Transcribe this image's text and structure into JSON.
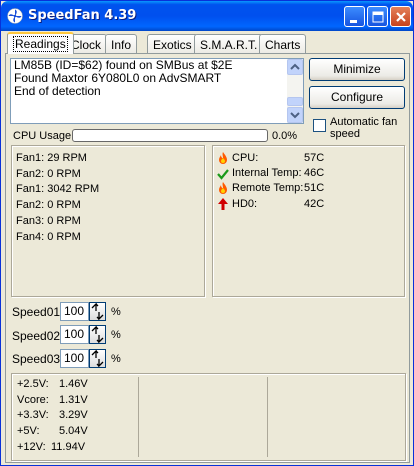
{
  "window": {
    "title": "SpeedFan 4.39"
  },
  "tabs": [
    "Readings",
    "Clock",
    "Info",
    "Exotics",
    "S.M.A.R.T.",
    "Charts"
  ],
  "log": {
    "lines": [
      "LM85B (ID=$62) found on SMBus at $2E",
      "Found Maxtor 6Y080L0 on AdvSMART",
      "End of detection"
    ]
  },
  "buttons": {
    "minimize": "Minimize",
    "configure": "Configure"
  },
  "auto_fan": {
    "label": "Automatic fan speed",
    "checked": false
  },
  "cpu_usage": {
    "label": "CPU Usage",
    "value": "0.0%",
    "fraction": 0.0
  },
  "fans": [
    {
      "label": "Fan1:",
      "value": "29 RPM"
    },
    {
      "label": "Fan2:",
      "value": "0 RPM"
    },
    {
      "label": "Fan1:",
      "value": "3042 RPM"
    },
    {
      "label": "Fan2:",
      "value": "0 RPM"
    },
    {
      "label": "Fan3:",
      "value": "0 RPM"
    },
    {
      "label": "Fan4:",
      "value": "0 RPM"
    }
  ],
  "temps": [
    {
      "label": "CPU:",
      "value": "57C",
      "icon": "flame-icon"
    },
    {
      "label": "Internal Temp:",
      "value": "46C",
      "icon": "checkmark-icon"
    },
    {
      "label": "Remote Temp:",
      "value": "51C",
      "icon": "flame-icon"
    },
    {
      "label": "HD0:",
      "value": "42C",
      "icon": "up-arrow-icon"
    }
  ],
  "speeds": [
    {
      "label": "Speed01:",
      "value": "100",
      "unit": "%"
    },
    {
      "label": "Speed02:",
      "value": "100",
      "unit": "%"
    },
    {
      "label": "Speed03:",
      "value": "100",
      "unit": "%"
    }
  ],
  "voltages": [
    {
      "label": "+2.5V:",
      "value": "1.46V"
    },
    {
      "label": "Vcore:",
      "value": "1.31V"
    },
    {
      "label": "+3.3V:",
      "value": "3.29V"
    },
    {
      "label": "+5V:",
      "value": "5.04V"
    },
    {
      "label": "+12V:",
      "value": "11.94V"
    }
  ],
  "colors": {
    "title_bar": "#0054e3",
    "flame": "#ff5a00",
    "check": "#1a9a1a",
    "arrow": "#d00000"
  }
}
